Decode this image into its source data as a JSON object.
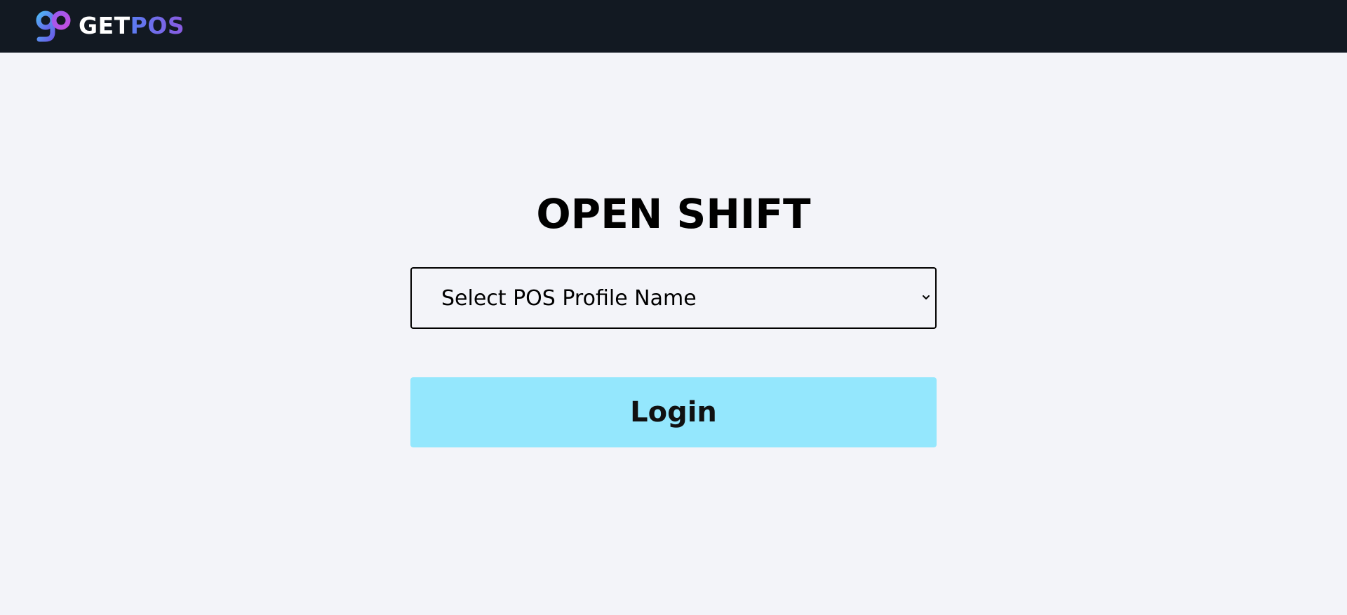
{
  "header": {
    "brand_prefix": "GET",
    "brand_suffix": "POS",
    "logo_icon": "getpos-logo-icon",
    "background_color": "#121922",
    "brand_gradient": [
      "#5b7cf2",
      "#8a5ae0"
    ]
  },
  "shift_form": {
    "title": "OPEN SHIFT",
    "profile_select": {
      "selected_value": "Select POS Profile Name",
      "icon": "chevron-down-icon"
    },
    "login_label": "Login",
    "login_color": "#94e7fd"
  },
  "page": {
    "background_color": "#f3f4f9"
  }
}
